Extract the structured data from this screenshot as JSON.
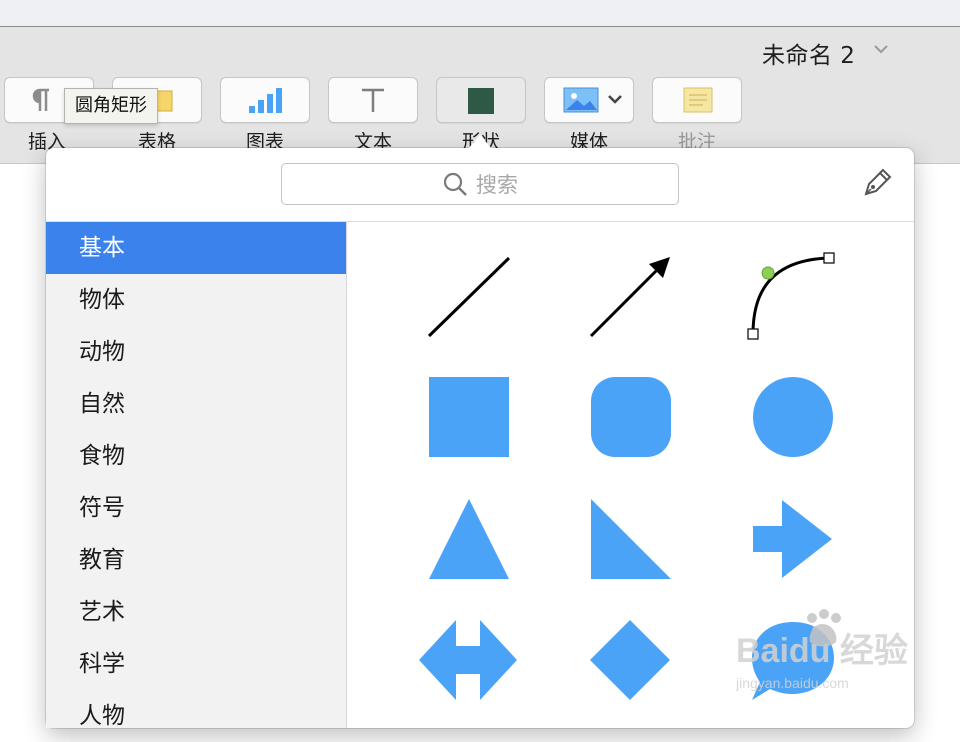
{
  "window": {
    "title": "未命名 2"
  },
  "toolbar": {
    "buttons": [
      {
        "label": "插入",
        "icon": "pilcrow-icon"
      },
      {
        "label": "表格",
        "icon": "table-icon"
      },
      {
        "label": "图表",
        "icon": "chart-icon"
      },
      {
        "label": "文本",
        "icon": "text-icon"
      },
      {
        "label": "形状",
        "icon": "shape-icon"
      },
      {
        "label": "媒体",
        "icon": "media-icon"
      },
      {
        "label": "批注",
        "icon": "comment-icon"
      }
    ],
    "tooltip": "圆角矩形"
  },
  "shapes_panel": {
    "search_placeholder": "搜索",
    "categories": [
      {
        "label": "基本",
        "selected": true
      },
      {
        "label": "物体"
      },
      {
        "label": "动物"
      },
      {
        "label": "自然"
      },
      {
        "label": "食物"
      },
      {
        "label": "符号"
      },
      {
        "label": "教育"
      },
      {
        "label": "艺术"
      },
      {
        "label": "科学"
      },
      {
        "label": "人物"
      }
    ],
    "shapes": [
      "line",
      "arrow-line",
      "curve",
      "square",
      "rounded-square",
      "circle",
      "triangle",
      "right-triangle",
      "arrow",
      "double-arrow",
      "diamond",
      "speech-bubble"
    ]
  },
  "colors": {
    "accent": "#3b82ed",
    "shape_fill": "#4ba3f7",
    "shape_button": "#2e5a45",
    "comment": "#f5e7a1"
  },
  "watermark": {
    "text": "Baidu 经验",
    "subtext": "jingyan.baidu.com"
  }
}
